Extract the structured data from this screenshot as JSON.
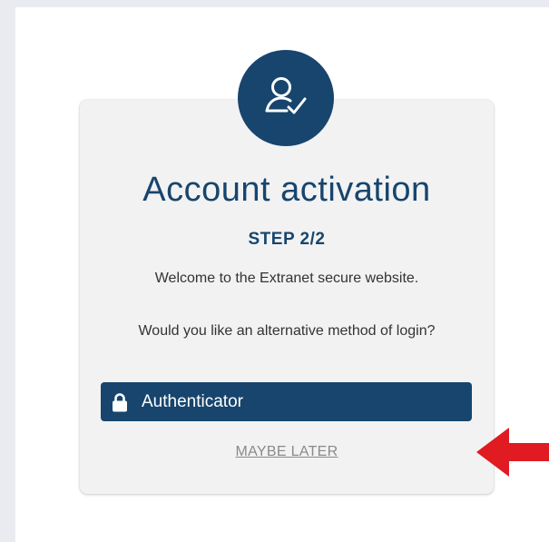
{
  "dialog": {
    "title": "Account activation",
    "step": "STEP 2/2",
    "welcome": "Welcome to the Extranet secure website.",
    "question": "Would you like an alternative method of login?",
    "authenticator_label": "Authenticator",
    "later_label": "MAYBE LATER"
  },
  "icons": {
    "avatar": "user-check-icon",
    "lock": "lock-icon",
    "arrow": "red-arrow-left-icon"
  },
  "colors": {
    "brand": "#17456d",
    "card_bg": "#f2f2f2",
    "page_bg": "#e9ebf0",
    "arrow": "#e01b22",
    "muted_link": "#8a8a8a"
  }
}
